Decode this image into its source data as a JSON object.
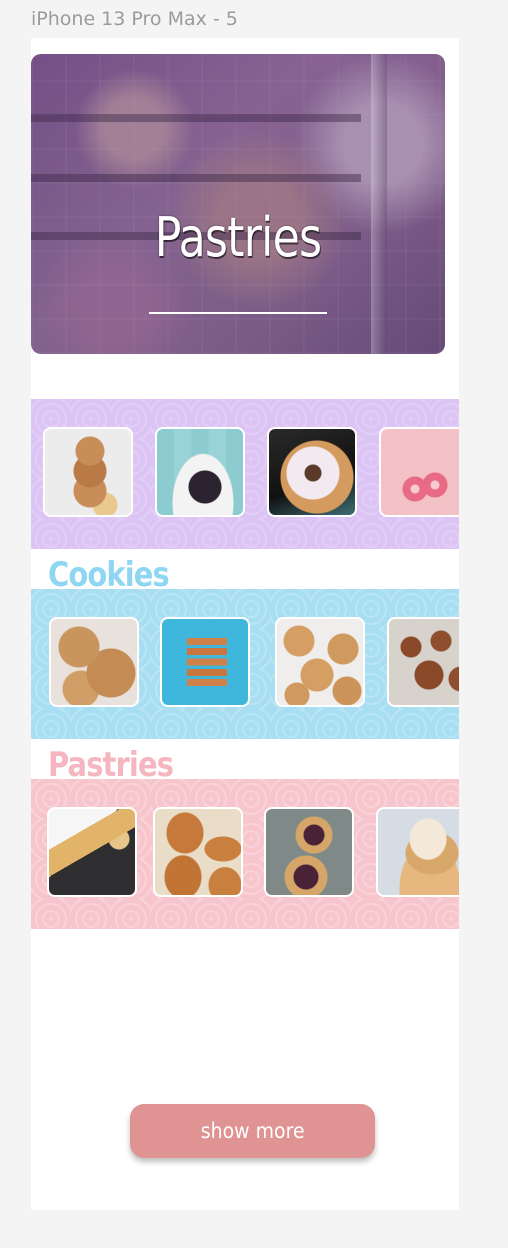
{
  "frame": {
    "label": "iPhone 13 Pro Max - 5"
  },
  "hero": {
    "title": "Pastries"
  },
  "sections": {
    "donuts": {
      "items": [
        {
          "name": "stacked-donuts-photo"
        },
        {
          "name": "chocolate-donut-photo"
        },
        {
          "name": "sprinkle-donut-photo"
        },
        {
          "name": "pink-donuts-photo"
        }
      ]
    },
    "cookies": {
      "title": "Cookies"
    },
    "pastries": {
      "title": "Pastries"
    }
  },
  "actions": {
    "show_more_label": "show more"
  },
  "colors": {
    "donut_band": "#dcc4f4",
    "cookie_band": "#a7def2",
    "pastry_band": "#f7c6cc",
    "cookie_title": "#8fd6f2",
    "pastry_title": "#f6b6bf",
    "button": "#e09393"
  }
}
